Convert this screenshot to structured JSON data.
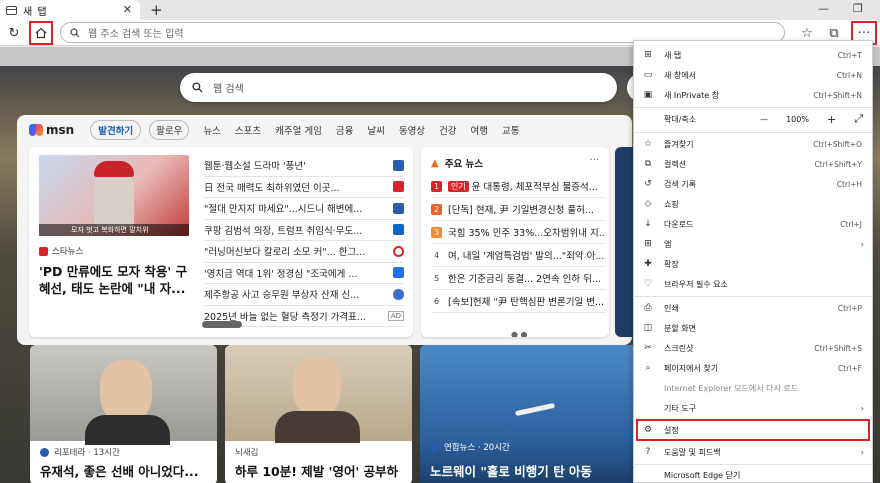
{
  "tab": {
    "title": "새 탭",
    "close": "✕"
  },
  "window": {
    "newtab": "+",
    "minimize": "—",
    "restore": "❐"
  },
  "address": {
    "placeholder": "웹 주소 검색 또는 입력"
  },
  "search": {
    "placeholder": "웹 검색"
  },
  "msn": {
    "logo": "msn",
    "nav": [
      "발견하기",
      "팔로우",
      "뉴스",
      "스포츠",
      "캐주얼 게임",
      "금융",
      "날씨",
      "동영상",
      "건강",
      "여행",
      "교통"
    ]
  },
  "hero": {
    "source": "스타뉴스",
    "title": "'PD 만류에도 모자 착용' 구혜선, 태도 논란에 \"내 자...",
    "caption": "모자 벗고 복화하면 말치위"
  },
  "headlines": [
    {
      "text": "웹툰·웹소설 드라마 '풍년'",
      "icon": "grid-icon"
    },
    {
      "text": "日 전국 매력도 최하위였던 이곳...",
      "icon": "news-icon"
    },
    {
      "text": "\"절대 만지지 마세요\"...시드니 해변에...",
      "icon": "grid-icon"
    },
    {
      "text": "쿠팡 김범석 의장, 트럼프 취임식·무도...",
      "icon": "linkedin-icon"
    },
    {
      "text": "\"러닝머신보다 칼로리 소모 커\"... 한그...",
      "icon": "c-icon"
    },
    {
      "text": "'영치금 역대 1위' 정경심 \"조국에게 ...",
      "icon": "s-icon"
    },
    {
      "text": "제주항공 사고 승무원 부상자 산재 신...",
      "icon": "shield-icon"
    },
    {
      "text": "2025년 바늘 없는 혈당 측정기 가격표...",
      "icon": "ad",
      "ad": "AD"
    }
  ],
  "trending": {
    "title": "주요 뉴스",
    "more": "···",
    "items": [
      {
        "num": "1",
        "hot": "인기",
        "text": "윤 대통령, 체포적부심 물증석...",
        "color": "#d8232a"
      },
      {
        "num": "2",
        "hot": "",
        "text": "[단독] 현재, 尹 기일변경신청 풀허...",
        "color": "#e8612c"
      },
      {
        "num": "3",
        "hot": "",
        "text": "국힘 35% 민주 33%...오차범위내 지...",
        "color": "#f08a3c"
      },
      {
        "num": "4",
        "hot": "",
        "text": "여, 내일 '계엄특검법' 발의...\"죄악 아...",
        "color": "#777777"
      },
      {
        "num": "5",
        "hot": "",
        "text": "한은 기준금리 동결... 2연속 인하 뒤...",
        "color": "#777777"
      },
      {
        "num": "6",
        "hot": "",
        "text": "[속보]헌재 \"尹 탄핵심판 변론기일 변...",
        "color": "#777777"
      }
    ],
    "dots": "● ●"
  },
  "cards": [
    {
      "source": "리포테라 · 13시간",
      "title": "유재석, 좋은 선배 아니었다...",
      "dot": "#2a5db0"
    },
    {
      "source": "뇌새김",
      "title": "하루 10분! 제발 '영어' 공부하",
      "dot": ""
    },
    {
      "source": "연합뉴스 · 20시간",
      "title": "노르웨이 \"홀로 비행기 탄 아동",
      "dot": "#2a5db0"
    }
  ],
  "menu": {
    "items": [
      {
        "label": "새 탭",
        "shortcut": "Ctrl+T",
        "icon": "new-tab-icon"
      },
      {
        "label": "새 창에서",
        "shortcut": "Ctrl+N",
        "icon": "new-window-icon"
      },
      {
        "label": "새 InPrivate 창",
        "shortcut": "Ctrl+Shift+N",
        "icon": "inprivate-icon"
      },
      {
        "label": "확대/축소",
        "shortcut": "",
        "icon": ""
      },
      {
        "label": "즐겨찾기",
        "shortcut": "Ctrl+Shift+O",
        "icon": "favorites-icon"
      },
      {
        "label": "컬렉션",
        "shortcut": "Ctrl+Shift+Y",
        "icon": "collections-icon"
      },
      {
        "label": "검색 기록",
        "shortcut": "Ctrl+H",
        "icon": "history-icon"
      },
      {
        "label": "쇼핑",
        "shortcut": "",
        "icon": "shopping-icon"
      },
      {
        "label": "다운로드",
        "shortcut": "Ctrl+J",
        "icon": "download-icon"
      },
      {
        "label": "앱",
        "shortcut": "",
        "icon": "apps-icon",
        "arrow": "›"
      },
      {
        "label": "확장",
        "shortcut": "",
        "icon": "extensions-icon"
      },
      {
        "label": "브라우저 필수 요소",
        "shortcut": "",
        "icon": "essentials-icon"
      },
      {
        "label": "인쇄",
        "shortcut": "Ctrl+P",
        "icon": "print-icon"
      },
      {
        "label": "분할 화면",
        "shortcut": "",
        "icon": "split-screen-icon"
      },
      {
        "label": "스크린샷",
        "shortcut": "Ctrl+Shift+S",
        "icon": "screenshot-icon"
      },
      {
        "label": "페이지에서 찾기",
        "shortcut": "Ctrl+F",
        "icon": "find-icon"
      },
      {
        "label": "Internet Explorer 모드에서 다시 로드",
        "shortcut": "",
        "icon": "ie-icon"
      },
      {
        "label": "기타 도구",
        "shortcut": "",
        "icon": "",
        "arrow": "›"
      },
      {
        "label": "설정",
        "shortcut": "",
        "icon": "settings-icon"
      },
      {
        "label": "도움말 및 피드백",
        "shortcut": "",
        "icon": "help-icon",
        "arrow": "›"
      },
      {
        "label": "Microsoft Edge 닫기",
        "shortcut": "",
        "icon": ""
      }
    ],
    "zoom": {
      "minus": "—",
      "value": "100%",
      "plus": "+",
      "fullscreen": "⤢"
    }
  },
  "colors": {
    "accent": "#1a5bb5",
    "highlight": "#d8232a"
  }
}
